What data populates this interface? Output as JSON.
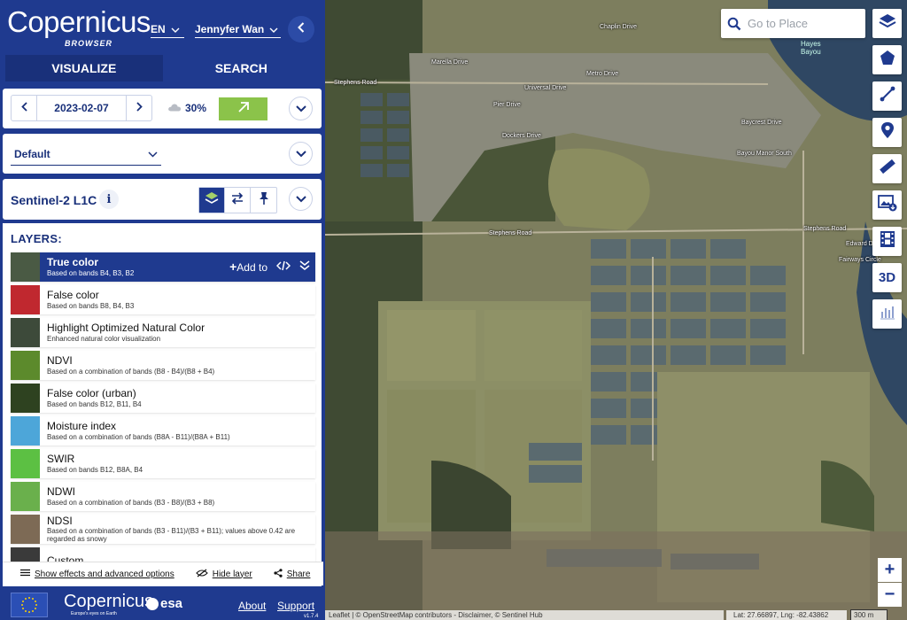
{
  "header": {
    "logo_text": "Copernicus",
    "logo_sub": "BROWSER",
    "language": "EN",
    "user_name": "Jennyfer Wan"
  },
  "tabs": [
    {
      "label": "VISUALIZE",
      "active": true
    },
    {
      "label": "SEARCH",
      "active": false
    }
  ],
  "date_panel": {
    "date": "2023-02-07",
    "cloud_coverage": "30%"
  },
  "theme": {
    "selected": "Default"
  },
  "dataset": {
    "name": "Sentinel-2 L1C",
    "info_symbol": "i"
  },
  "layers": {
    "heading": "LAYERS:",
    "items": [
      {
        "name": "True color",
        "desc": "Based on bands B4, B3, B2",
        "thumb": "#4a5a44",
        "selected": true
      },
      {
        "name": "False color",
        "desc": "Based on bands B8, B4, B3",
        "thumb": "#c0282f"
      },
      {
        "name": "Highlight Optimized Natural Color",
        "desc": "Enhanced natural color visualization",
        "thumb": "#3d4a3a"
      },
      {
        "name": "NDVI",
        "desc": "Based on a combination of bands (B8 - B4)/(B8 + B4)",
        "thumb": "#5c8a2c"
      },
      {
        "name": "False color (urban)",
        "desc": "Based on bands B12, B11, B4",
        "thumb": "#2e4220"
      },
      {
        "name": "Moisture index",
        "desc": "Based on a combination of bands (B8A - B11)/(B8A + B11)",
        "thumb": "#4da6d9"
      },
      {
        "name": "SWIR",
        "desc": "Based on bands B12, B8A, B4",
        "thumb": "#5cc043"
      },
      {
        "name": "NDWI",
        "desc": "Based on a combination of bands (B3 - B8)/(B3 + B8)",
        "thumb": "#6ab04c"
      },
      {
        "name": "NDSI",
        "desc": "Based on a combination of bands (B3 - B11)/(B3 + B11); values above 0.42 are regarded as snowy",
        "thumb": "#7d6a55"
      },
      {
        "name": "Custom",
        "desc": "",
        "thumb": "#3a3a3a"
      }
    ],
    "add_to_label": "Add to"
  },
  "footer_links": {
    "effects": "Show effects and advanced options",
    "hide_layer": "Hide layer",
    "share": "Share"
  },
  "bottom_bar": {
    "small_logo": "Copernicus",
    "small_logo_tag": "Europe's eyes on Earth",
    "esa": "esa",
    "about": "About",
    "support": "Support",
    "version": "v1.7.4"
  },
  "map": {
    "search_placeholder": "Go to Place",
    "three_d_label": "3D",
    "zoom_in": "+",
    "zoom_out": "−",
    "attribution": "Leaflet | © OpenStreetMap contributors - Disclaimer, © Sentinel Hub",
    "coordinates": "Lat: 27.66897, Lng: -82.43862",
    "scale": "300 m",
    "water_label": "Hayes Bayou",
    "road_labels": [
      "Stephens Road",
      "Stephens Road",
      "Stephens Road",
      "Universal Drive",
      "Metro Drive",
      "Pier Drive",
      "Dockers Drive",
      "Marella Drive",
      "Fairways Circle",
      "Edward Drive",
      "Bayou Manor South",
      "Baycrest Drive",
      "Chaplin Drive"
    ]
  },
  "colors": {
    "brand_blue": "#1f3a8f",
    "accent_green": "#8bc34a",
    "map_bg": "#7a7b5c"
  }
}
